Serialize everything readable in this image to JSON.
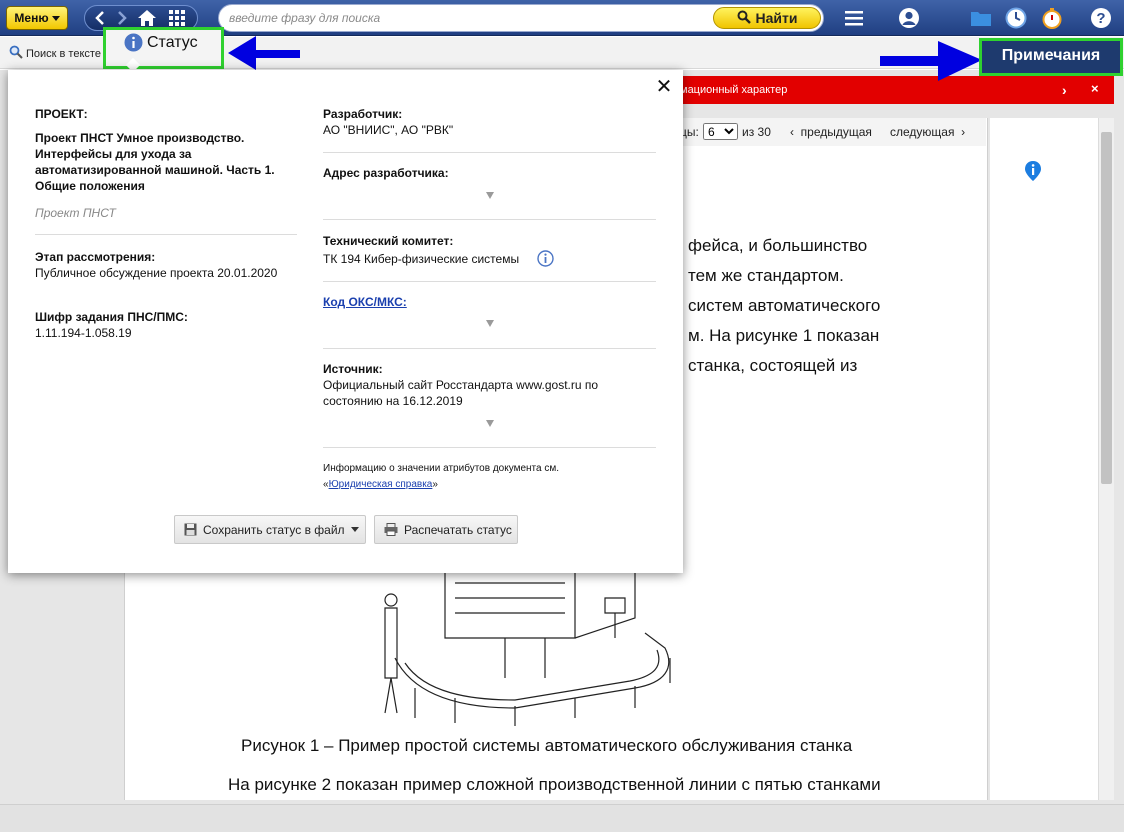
{
  "toolbar": {
    "menu_label": "Меню",
    "search_placeholder": "введите фразу для поиска",
    "find_label": "Найти",
    "icons": [
      "back-icon",
      "forward-icon",
      "home-icon",
      "grid-icon",
      "hamburger-icon",
      "user-icon",
      "folder-icon",
      "clock-icon",
      "timer-icon",
      "help-icon"
    ]
  },
  "subbar": {
    "search_in_text": "Поиск в тексте"
  },
  "tabs": {
    "status_label": "Статус",
    "notes_label": "Примечания"
  },
  "banner": {
    "text": "мационный характер"
  },
  "pagination": {
    "label": "цы:",
    "current_page": "6",
    "of_label": "из 30",
    "prev_label": "предыдущая",
    "next_label": "следующая"
  },
  "document": {
    "lines": [
      "фейса,  и  большинство",
      "тем же стандартом.",
      "систем   автоматического",
      "м. На рисунке 1 показан",
      "станка,  состоящей  из"
    ],
    "figure_caption": "Рисунок 1 – Пример простой системы автоматического обслуживания станка",
    "next_paragraph": "На рисунке 2 показан пример сложной производственной линии с пятью станками"
  },
  "modal": {
    "left": {
      "project_label": "ПРОЕКТ:",
      "project_title": "Проект ПНСТ Умное производство. Интерфейсы для ухода за автоматизированной машиной. Часть 1. Общие положения",
      "project_type": "Проект ПНСТ",
      "stage_label": "Этап рассмотрения:",
      "stage_value": "Публичное обсуждение проекта 20.01.2020",
      "code_label": "Шифр задания ПНС/ПМС:",
      "code_value": "1.11.194-1.058.19"
    },
    "right": {
      "developer_label": "Разработчик:",
      "developer_value": "АО \"ВНИИС\", АО \"РВК\"",
      "dev_address_label": "Адрес разработчика:",
      "tech_committee_label": "Технический комитет:",
      "tech_committee_value": "ТК 194 Кибер-физические системы",
      "oks_label": "Код ОКС/МКС:",
      "source_label": "Источник:",
      "source_value": "Официальный сайт Росстандарта www.gost.ru по состоянию на 16.12.2019",
      "info_note": "Информацию о значении атрибутов документа см.",
      "info_link": "Юридическая справка",
      "info_quote_open": "«",
      "info_quote_close": "»"
    },
    "buttons": {
      "save_label": "Сохранить статус в файл",
      "print_label": "Распечатать статус"
    },
    "close_glyph": "✕"
  },
  "colors": {
    "toolbar": "#2c4d91",
    "accent_yellow": "#f2c700",
    "highlight_green": "#2fd12f",
    "arrow_blue": "#0000e0",
    "banner_red": "#e20000",
    "link_blue": "#1a3fae"
  }
}
